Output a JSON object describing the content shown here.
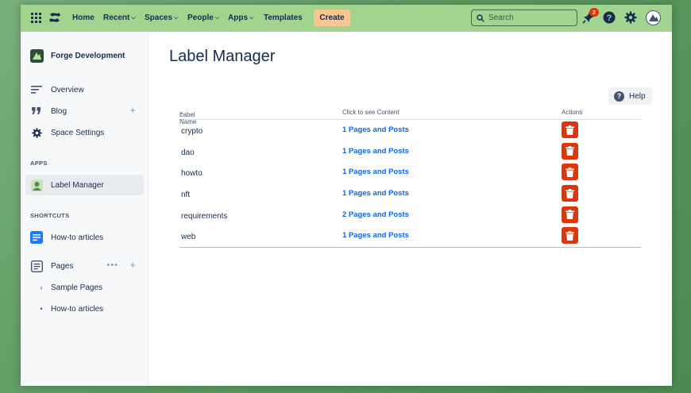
{
  "colors": {
    "nav_bg": "#a2d48f",
    "create_bg": "#f8c68e",
    "link": "#0c66e4",
    "danger": "#de350b",
    "text": "#172b4d"
  },
  "nav": {
    "home": "Home",
    "recent": "Recent",
    "spaces": "Spaces",
    "people": "People",
    "apps": "Apps",
    "templates": "Templates",
    "create": "Create",
    "search_placeholder": "Search",
    "notifications_count": "2"
  },
  "sidebar": {
    "space_name": "Forge Development",
    "overview": "Overview",
    "blog": "Blog",
    "space_settings": "Space Settings",
    "apps_section": "APPS",
    "label_manager": "Label Manager",
    "shortcuts_section": "SHORTCUTS",
    "howto_articles": "How-to articles",
    "pages": "Pages",
    "page_children": [
      "Sample Pages",
      "How-to articles"
    ]
  },
  "main": {
    "title": "Label Manager",
    "help": "Help",
    "columns": {
      "label_name": "Label Name",
      "content": "Click to see Content",
      "actions": "Actions"
    },
    "rows": [
      {
        "label": "crypto",
        "content": "1 Pages and Posts"
      },
      {
        "label": "dao",
        "content": "1 Pages and Posts"
      },
      {
        "label": "howto",
        "content": "1 Pages and Posts"
      },
      {
        "label": "nft",
        "content": "1 Pages and Posts"
      },
      {
        "label": "requirements",
        "content": "2 Pages and Posts"
      },
      {
        "label": "web",
        "content": "1 Pages and Posts"
      }
    ]
  }
}
